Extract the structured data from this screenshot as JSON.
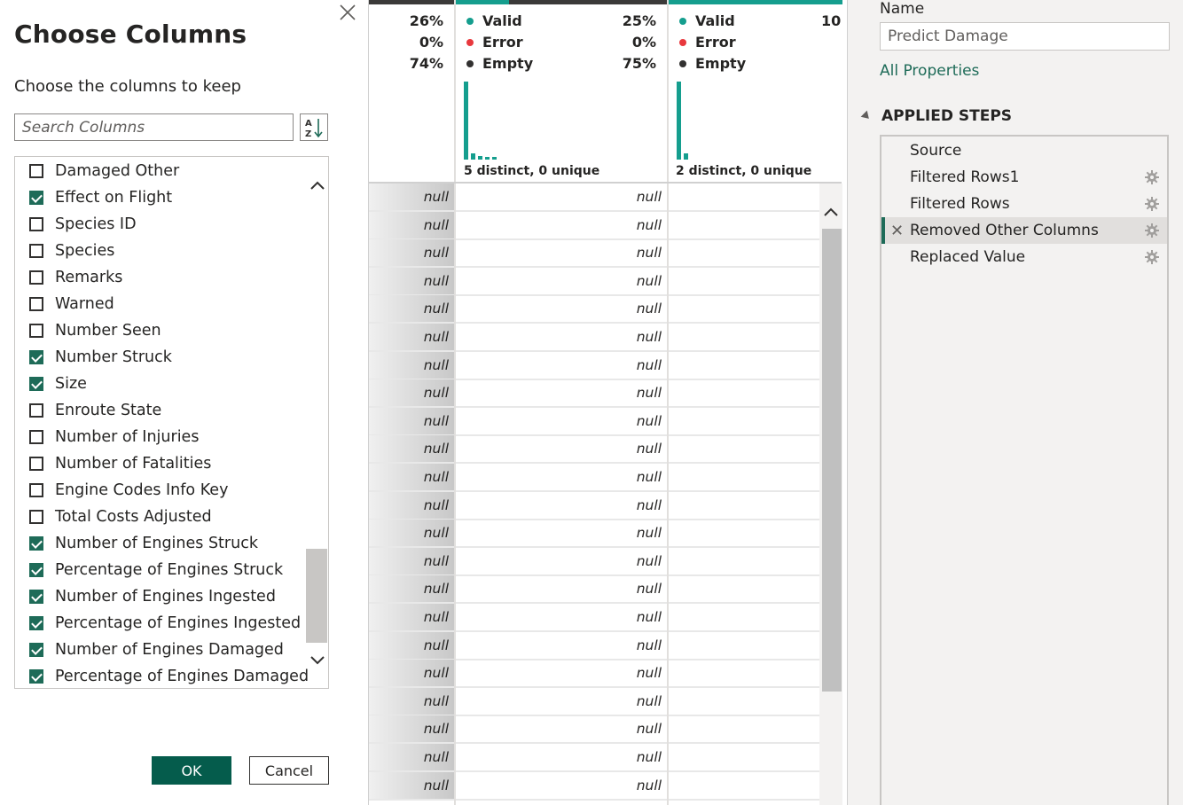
{
  "dialog": {
    "title": "Choose Columns",
    "subtitle": "Choose the columns to keep",
    "search_placeholder": "Search Columns",
    "sort_button_icon": "sort-az-icon",
    "close_icon": "close-icon",
    "columns": [
      {
        "label": "Damaged Other",
        "checked": false
      },
      {
        "label": "Effect on Flight",
        "checked": true
      },
      {
        "label": "Species ID",
        "checked": false
      },
      {
        "label": "Species",
        "checked": false
      },
      {
        "label": "Remarks",
        "checked": false
      },
      {
        "label": "Warned",
        "checked": false
      },
      {
        "label": "Number Seen",
        "checked": false
      },
      {
        "label": "Number Struck",
        "checked": true
      },
      {
        "label": "Size",
        "checked": true
      },
      {
        "label": "Enroute State",
        "checked": false
      },
      {
        "label": "Number of Injuries",
        "checked": false
      },
      {
        "label": "Number of Fatalities",
        "checked": false
      },
      {
        "label": "Engine Codes Info Key",
        "checked": false
      },
      {
        "label": "Total Costs Adjusted",
        "checked": false
      },
      {
        "label": "Number of Engines Struck",
        "checked": true
      },
      {
        "label": "Percentage of Engines Struck",
        "checked": true
      },
      {
        "label": "Number of Engines Ingested",
        "checked": true
      },
      {
        "label": "Percentage of Engines Ingested",
        "checked": true
      },
      {
        "label": "Number of Engines Damaged",
        "checked": true
      },
      {
        "label": "Percentage of Engines Damaged",
        "checked": true
      }
    ],
    "ok_label": "OK",
    "cancel_label": "Cancel",
    "list_scroll_position": 0.78
  },
  "grid": {
    "columns": [
      {
        "valid_pct": "26%",
        "error_pct": "0%",
        "empty_pct": "74%"
      },
      {
        "valid_label": "Valid",
        "error_label": "Error",
        "empty_label": "Empty",
        "valid_pct": "25%",
        "error_pct": "0%",
        "empty_pct": "75%",
        "distinct": "5 distinct, 0 unique",
        "histogram": [
          1.0,
          0.08,
          0.05,
          0.03,
          0.03
        ]
      },
      {
        "valid_label": "Valid",
        "error_label": "Error",
        "empty_label": "Empty",
        "valid_pct_partial": "10",
        "distinct": "2 distinct, 0 unique",
        "histogram": [
          1.0,
          0.08
        ]
      }
    ],
    "null_text": "null",
    "row_count": 22,
    "colors": {
      "valid": "#159e8e",
      "error": "#e8383d",
      "empty": "#323130",
      "header_dark": "#3b3a39"
    }
  },
  "right_pane": {
    "name_label": "Name",
    "name_value": "Predict Damage",
    "all_properties": "All Properties",
    "applied_steps_header": "APPLIED STEPS",
    "steps": [
      {
        "label": "Source",
        "gear": false,
        "active": false
      },
      {
        "label": "Filtered Rows1",
        "gear": true,
        "active": false
      },
      {
        "label": "Filtered Rows",
        "gear": true,
        "active": false
      },
      {
        "label": "Removed Other Columns",
        "gear": true,
        "active": true
      },
      {
        "label": "Replaced Value",
        "gear": true,
        "active": false
      }
    ]
  }
}
